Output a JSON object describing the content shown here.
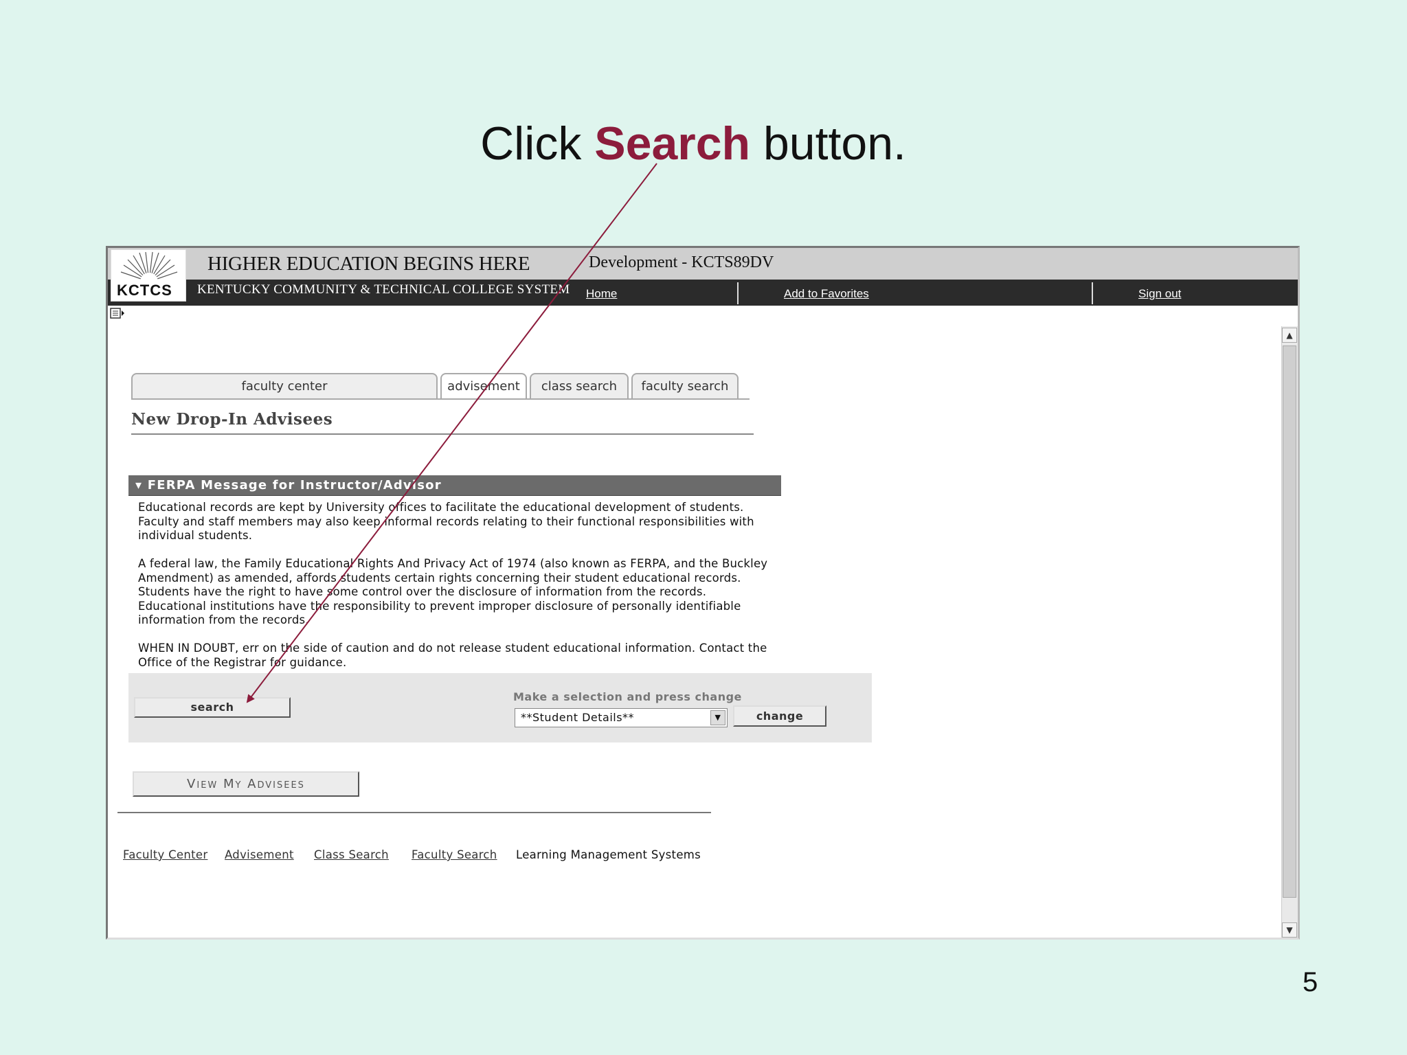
{
  "slide": {
    "title_prefix": "Click ",
    "title_emphasis": "Search",
    "title_suffix": " button.",
    "page_number": "5",
    "accent_color": "#8c1c3c"
  },
  "banner": {
    "logo_text": "KCTCS",
    "tagline": "HIGHER EDUCATION BEGINS HERE",
    "college": "KENTUCKY COMMUNITY & TECHNICAL COLLEGE SYSTEM",
    "environment": "Development - KCTS89DV",
    "nav": [
      "Home",
      "Add to Favorites",
      "Sign out"
    ]
  },
  "tabs": [
    {
      "label": "faculty center",
      "active": false
    },
    {
      "label": "advisement",
      "active": true
    },
    {
      "label": "class search",
      "active": false
    },
    {
      "label": "faculty search",
      "active": false
    }
  ],
  "page_heading": "New Drop-In Advisees",
  "ferpa": {
    "header": "FERPA Message for Instructor/Advisor",
    "paragraphs": [
      "Educational records are kept by University offices to facilitate the educational development of students. Faculty and staff members may also keep informal records relating to their functional responsibilities with individual students.",
      "A federal law, the Family Educational Rights And Privacy Act of 1974 (also known as FERPA, and the Buckley Amendment) as amended, affords students certain rights concerning their student educational records. Students have the right to have some control over the disclosure of information from the records. Educational institutions have the responsibility to prevent improper disclosure of personally identifiable information from the records.",
      "WHEN IN DOUBT, err on the side of caution and do not release student educational information. Contact the Office of the Registrar for guidance."
    ]
  },
  "actions": {
    "search_label": "search",
    "select_label": "Make a selection and press change",
    "select_value": "**Student Details**",
    "change_label": "change",
    "view_advisees_label": "View My Advisees"
  },
  "footer_links": [
    "Faculty Center",
    "Advisement",
    "Class Search",
    "Faculty Search"
  ],
  "footer_text": "Learning Management Systems"
}
